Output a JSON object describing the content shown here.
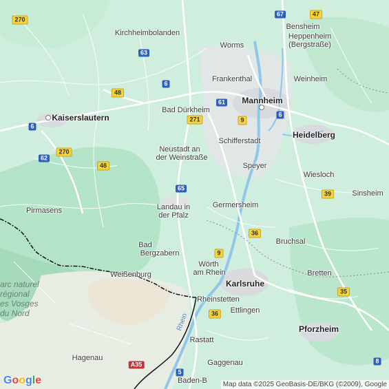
{
  "map": {
    "cities": [
      {
        "id": "bensheim",
        "label": "Bensheim",
        "bold": false
      },
      {
        "id": "heppenheim",
        "label": "Heppenheim",
        "bold": false
      },
      {
        "id": "bergstrasse",
        "label": "(Bergstraße)",
        "bold": false
      },
      {
        "id": "kirchheimbolanden",
        "label": "Kirchheimbolanden",
        "bold": false
      },
      {
        "id": "worms",
        "label": "Worms",
        "bold": false
      },
      {
        "id": "frankenthal",
        "label": "Frankenthal",
        "bold": false
      },
      {
        "id": "weinheim",
        "label": "Weinheim",
        "bold": false
      },
      {
        "id": "mannheim",
        "label": "Mannheim",
        "bold": true
      },
      {
        "id": "bad-durkheim",
        "label": "Bad Dürkheim",
        "bold": false
      },
      {
        "id": "kaiserslautern",
        "label": "Kaiserslautern",
        "bold": true
      },
      {
        "id": "heidelberg",
        "label": "Heidelberg",
        "bold": true
      },
      {
        "id": "schifferstadt",
        "label": "Schifferstadt",
        "bold": false
      },
      {
        "id": "neustadt-1",
        "label": "Neustadt an",
        "bold": false
      },
      {
        "id": "neustadt-2",
        "label": "der Weinstraße",
        "bold": false
      },
      {
        "id": "speyer",
        "label": "Speyer",
        "bold": false
      },
      {
        "id": "wiesloch",
        "label": "Wiesloch",
        "bold": false
      },
      {
        "id": "sinsheim",
        "label": "Sinsheim",
        "bold": false
      },
      {
        "id": "pirmasens",
        "label": "Pirmasens",
        "bold": false
      },
      {
        "id": "landau-1",
        "label": "Landau in",
        "bold": false
      },
      {
        "id": "landau-2",
        "label": "der Pfalz",
        "bold": false
      },
      {
        "id": "germersheim",
        "label": "Germersheim",
        "bold": false
      },
      {
        "id": "bruchsal",
        "label": "Bruchsal",
        "bold": false
      },
      {
        "id": "bad-bergzabern-1",
        "label": "Bad",
        "bold": false
      },
      {
        "id": "bad-bergzabern-2",
        "label": "Bergzabern",
        "bold": false
      },
      {
        "id": "worth-1",
        "label": "Wörth",
        "bold": false
      },
      {
        "id": "worth-2",
        "label": "am Rhein",
        "bold": false
      },
      {
        "id": "weissenburg",
        "label": "Weißenburg",
        "bold": false
      },
      {
        "id": "bretten",
        "label": "Bretten",
        "bold": false
      },
      {
        "id": "karlsruhe",
        "label": "Karlsruhe",
        "bold": true
      },
      {
        "id": "rheinstetten",
        "label": "Rheinstetten",
        "bold": false
      },
      {
        "id": "ettlingen",
        "label": "Ettlingen",
        "bold": false
      },
      {
        "id": "pforzheim",
        "label": "Pforzheim",
        "bold": true
      },
      {
        "id": "rastatt",
        "label": "Rastatt",
        "bold": false
      },
      {
        "id": "hagenau",
        "label": "Hagenau",
        "bold": false
      },
      {
        "id": "gaggenau",
        "label": "Gaggenau",
        "bold": false
      },
      {
        "id": "baden-b",
        "label": "Baden-B",
        "bold": false
      }
    ],
    "region_lines": [
      "arc naturel",
      "régional",
      "es Vosges",
      "du Nord"
    ],
    "river_label": "Rhein",
    "shields": [
      {
        "id": "r270-top",
        "label": "270",
        "type": "b"
      },
      {
        "id": "r67",
        "label": "67",
        "type": "a"
      },
      {
        "id": "r47",
        "label": "47",
        "type": "b"
      },
      {
        "id": "r63",
        "label": "63",
        "type": "a"
      },
      {
        "id": "r6-a",
        "label": "6",
        "type": "a"
      },
      {
        "id": "r48-top",
        "label": "48",
        "type": "b"
      },
      {
        "id": "r61",
        "label": "61",
        "type": "a"
      },
      {
        "id": "r271",
        "label": "271",
        "type": "b"
      },
      {
        "id": "r9-top",
        "label": "9",
        "type": "b"
      },
      {
        "id": "r6-b",
        "label": "6",
        "type": "a"
      },
      {
        "id": "r6-c",
        "label": "6",
        "type": "a"
      },
      {
        "id": "r62",
        "label": "62",
        "type": "a"
      },
      {
        "id": "r270",
        "label": "270",
        "type": "b"
      },
      {
        "id": "r48",
        "label": "48",
        "type": "b"
      },
      {
        "id": "r65",
        "label": "65",
        "type": "a"
      },
      {
        "id": "r39",
        "label": "39",
        "type": "b"
      },
      {
        "id": "r36-a",
        "label": "36",
        "type": "b"
      },
      {
        "id": "r9-b",
        "label": "9",
        "type": "b"
      },
      {
        "id": "r35",
        "label": "35",
        "type": "b"
      },
      {
        "id": "r36-b",
        "label": "36",
        "type": "b"
      },
      {
        "id": "r8",
        "label": "8",
        "type": "a"
      },
      {
        "id": "rA35",
        "label": "A35",
        "type": "e"
      },
      {
        "id": "r5",
        "label": "5",
        "type": "a"
      }
    ]
  },
  "logo": {
    "text": "Google"
  },
  "attribution": {
    "text": "Map data ©2025 GeoBasis-DE/BKG (©2009), Google"
  },
  "colors": {
    "land": "#cfeedd",
    "forest": "#a9dfbf",
    "urban": "#dcdfe2",
    "water": "#8ec7e8",
    "highway": "#ffffff",
    "border": "#111111"
  }
}
